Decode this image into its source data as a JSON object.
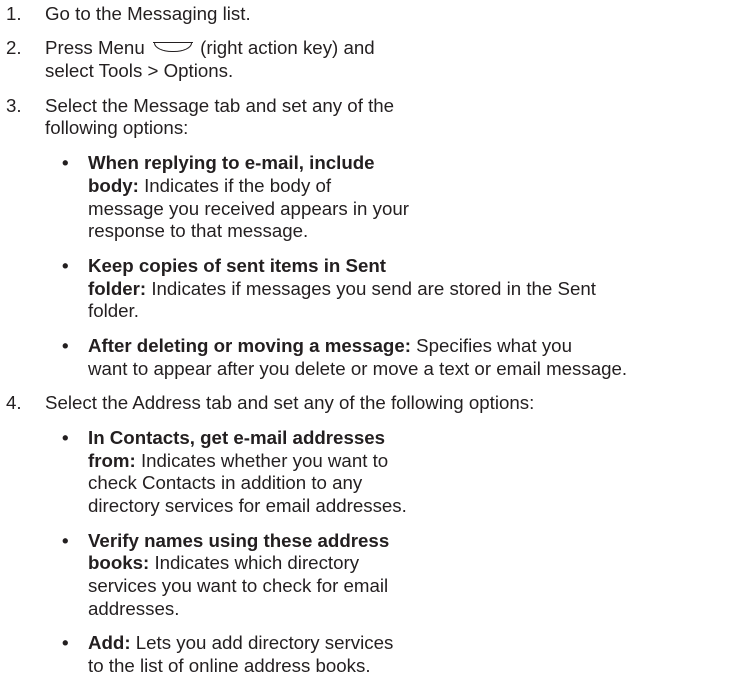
{
  "steps": [
    {
      "num": "1.",
      "text": "Go to the Messaging list."
    },
    {
      "num": "2.",
      "line1_before": "Press Menu",
      "line1_after": "(right action key) and",
      "line2": "select Tools > Options."
    },
    {
      "num": "3.",
      "line1": "Select the Message tab and set any of the",
      "line2": "following options:",
      "options": [
        {
          "bold1": "When replying to e-mail, include",
          "bold2": "body:",
          "rest2": " Indicates if the body of",
          "line3": "message you received appears in your",
          "line4": "response to that message."
        },
        {
          "bold1": "Keep copies of sent items in Sent",
          "bold2": "folder:",
          "rest2": " Indicates if messages you send are stored in the Sent",
          "line3": "folder."
        },
        {
          "bold1": "After deleting or moving a message:",
          "rest1": " Specifies what you",
          "line2": "want to appear after you delete or move a text or email message."
        }
      ]
    },
    {
      "num": "4.",
      "line1": "Select the Address tab and set any of the following options:",
      "options": [
        {
          "bold1": "In Contacts, get e-mail addresses",
          "bold2": "from:",
          "rest2": " Indicates whether you want to",
          "line3": "check Contacts in addition to any",
          "line4": "directory services for email addresses."
        },
        {
          "bold1": "Verify names using these address",
          "bold2": "books:",
          "rest2": " Indicates which directory",
          "line3": "services you want to check for email",
          "line4": "addresses."
        },
        {
          "bold1": "Add:",
          "rest1": " Lets you add directory services",
          "line2": "to the list of online address books."
        }
      ]
    }
  ],
  "icons": {
    "menu_key": "right-action-key-icon"
  }
}
